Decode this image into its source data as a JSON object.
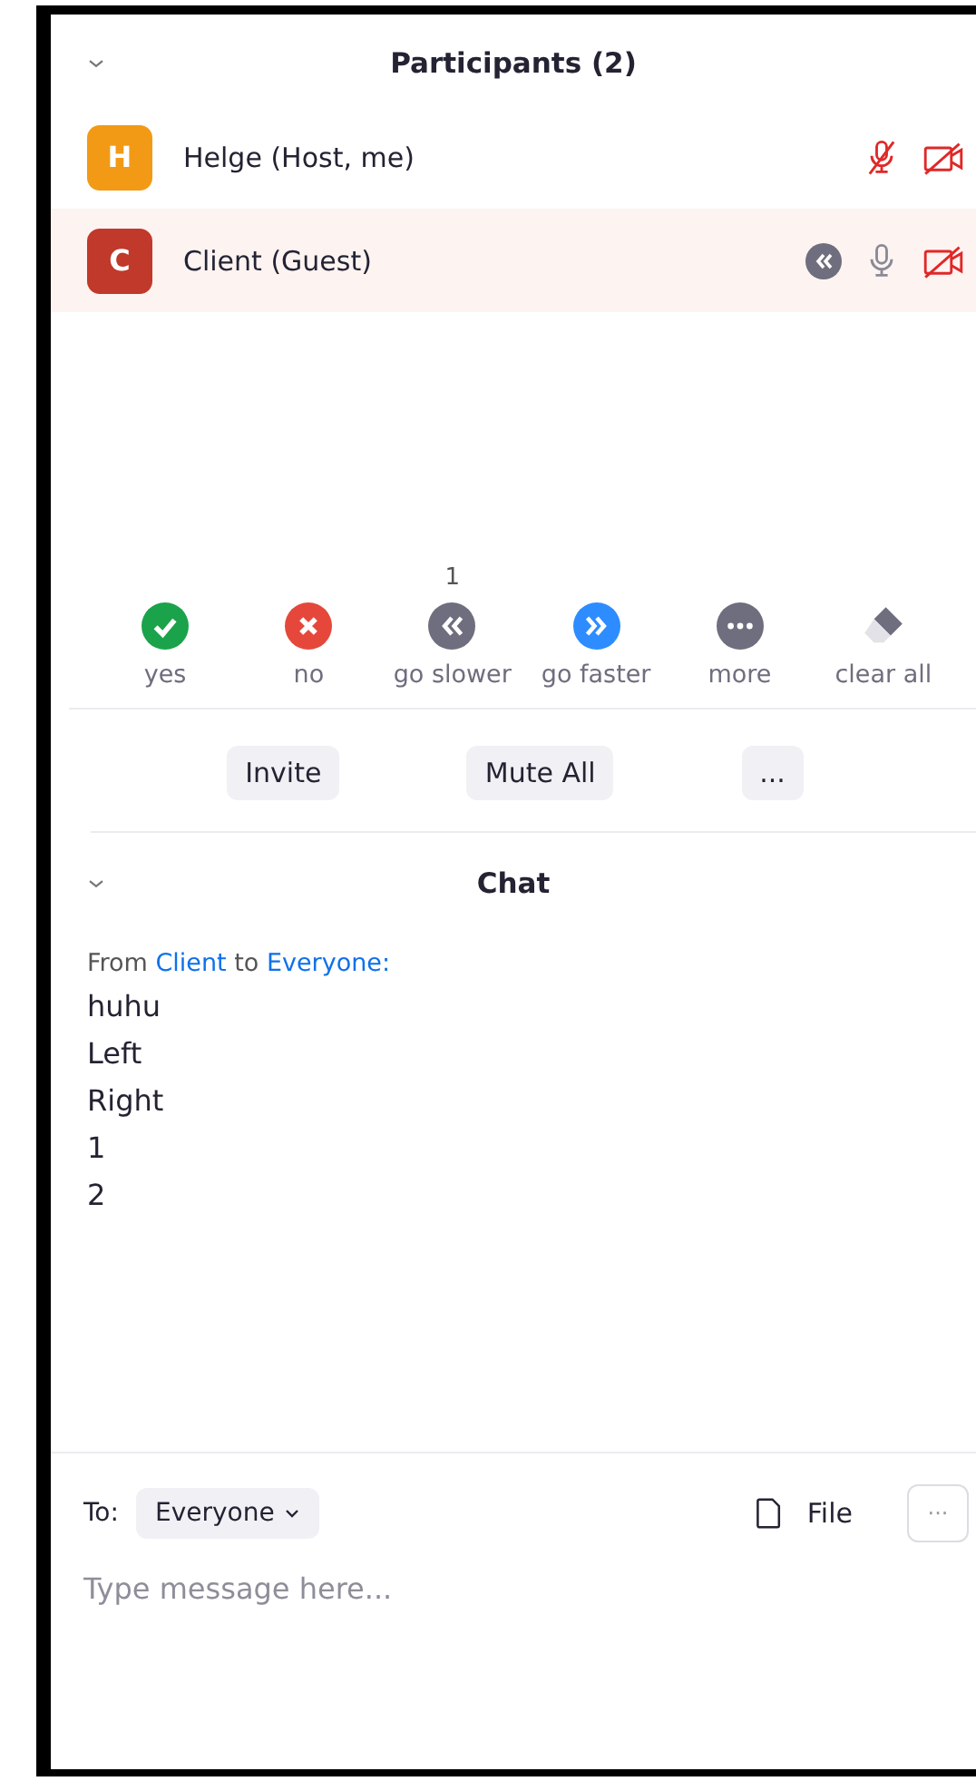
{
  "participants_panel": {
    "title": "Participants (2)",
    "expanded": true,
    "participants": [
      {
        "initial": "H",
        "name": "Helge (Host, me)",
        "color": "#f29a16",
        "highlighted": false,
        "asks_slower": false,
        "audio_muted": true,
        "video_off": true
      },
      {
        "initial": "C",
        "name": "Client (Guest)",
        "color": "#c0392b",
        "highlighted": true,
        "asks_slower": true,
        "audio_muted": false,
        "video_off": true
      }
    ],
    "feedback": [
      {
        "kind": "yes",
        "label": "yes"
      },
      {
        "kind": "no",
        "label": "no"
      },
      {
        "kind": "slower",
        "label": "go slower",
        "count": "1"
      },
      {
        "kind": "faster",
        "label": "go faster"
      },
      {
        "kind": "more",
        "label": "more"
      },
      {
        "kind": "clear",
        "label": "clear all"
      }
    ],
    "buttons": [
      "Invite",
      "Mute All",
      "..."
    ]
  },
  "chat_panel": {
    "title": "Chat",
    "expanded": true,
    "messages": [
      {
        "from_prefix": "From",
        "sender": "Client",
        "to_word": "to",
        "recipient": "Everyone:",
        "lines": [
          "huhu",
          "Left",
          "Right",
          "1",
          "2"
        ]
      }
    ],
    "to_label": "To:",
    "recipient_select": "Everyone",
    "file_label": "File",
    "more_button": "···",
    "input": {
      "placeholder": "Type message here..."
    }
  }
}
